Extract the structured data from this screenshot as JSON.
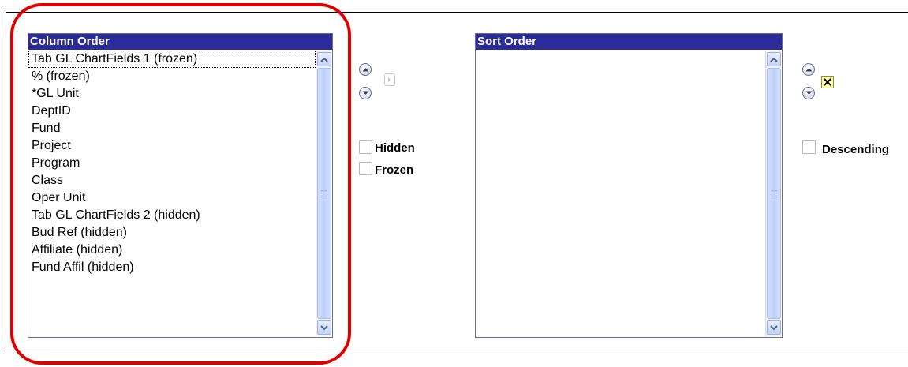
{
  "column_order": {
    "header": "Column Order",
    "items": [
      "Tab GL ChartFields 1 (frozen)",
      "% (frozen)",
      "*GL Unit",
      "DeptID",
      "Fund",
      "Project",
      "Program",
      "Class",
      "Oper Unit",
      "Tab GL ChartFields 2 (hidden)",
      "Bud Ref (hidden)",
      "Affiliate (hidden)",
      "Fund Affil (hidden)"
    ],
    "selected_index": 0,
    "options": {
      "hidden_label": "Hidden",
      "frozen_label": "Frozen"
    }
  },
  "sort_order": {
    "header": "Sort Order",
    "items": [],
    "options": {
      "descending_label": "Descending"
    }
  },
  "colors": {
    "header_bg": "#2b2b9a",
    "highlight": "#e00000",
    "delete_button": "#ffffa8"
  },
  "icons": [
    "move-up-icon",
    "move-down-icon",
    "add-to-sort-arrow-icon",
    "delete-x-icon",
    "scroll-up-arrow-icon",
    "scroll-down-arrow-icon"
  ]
}
